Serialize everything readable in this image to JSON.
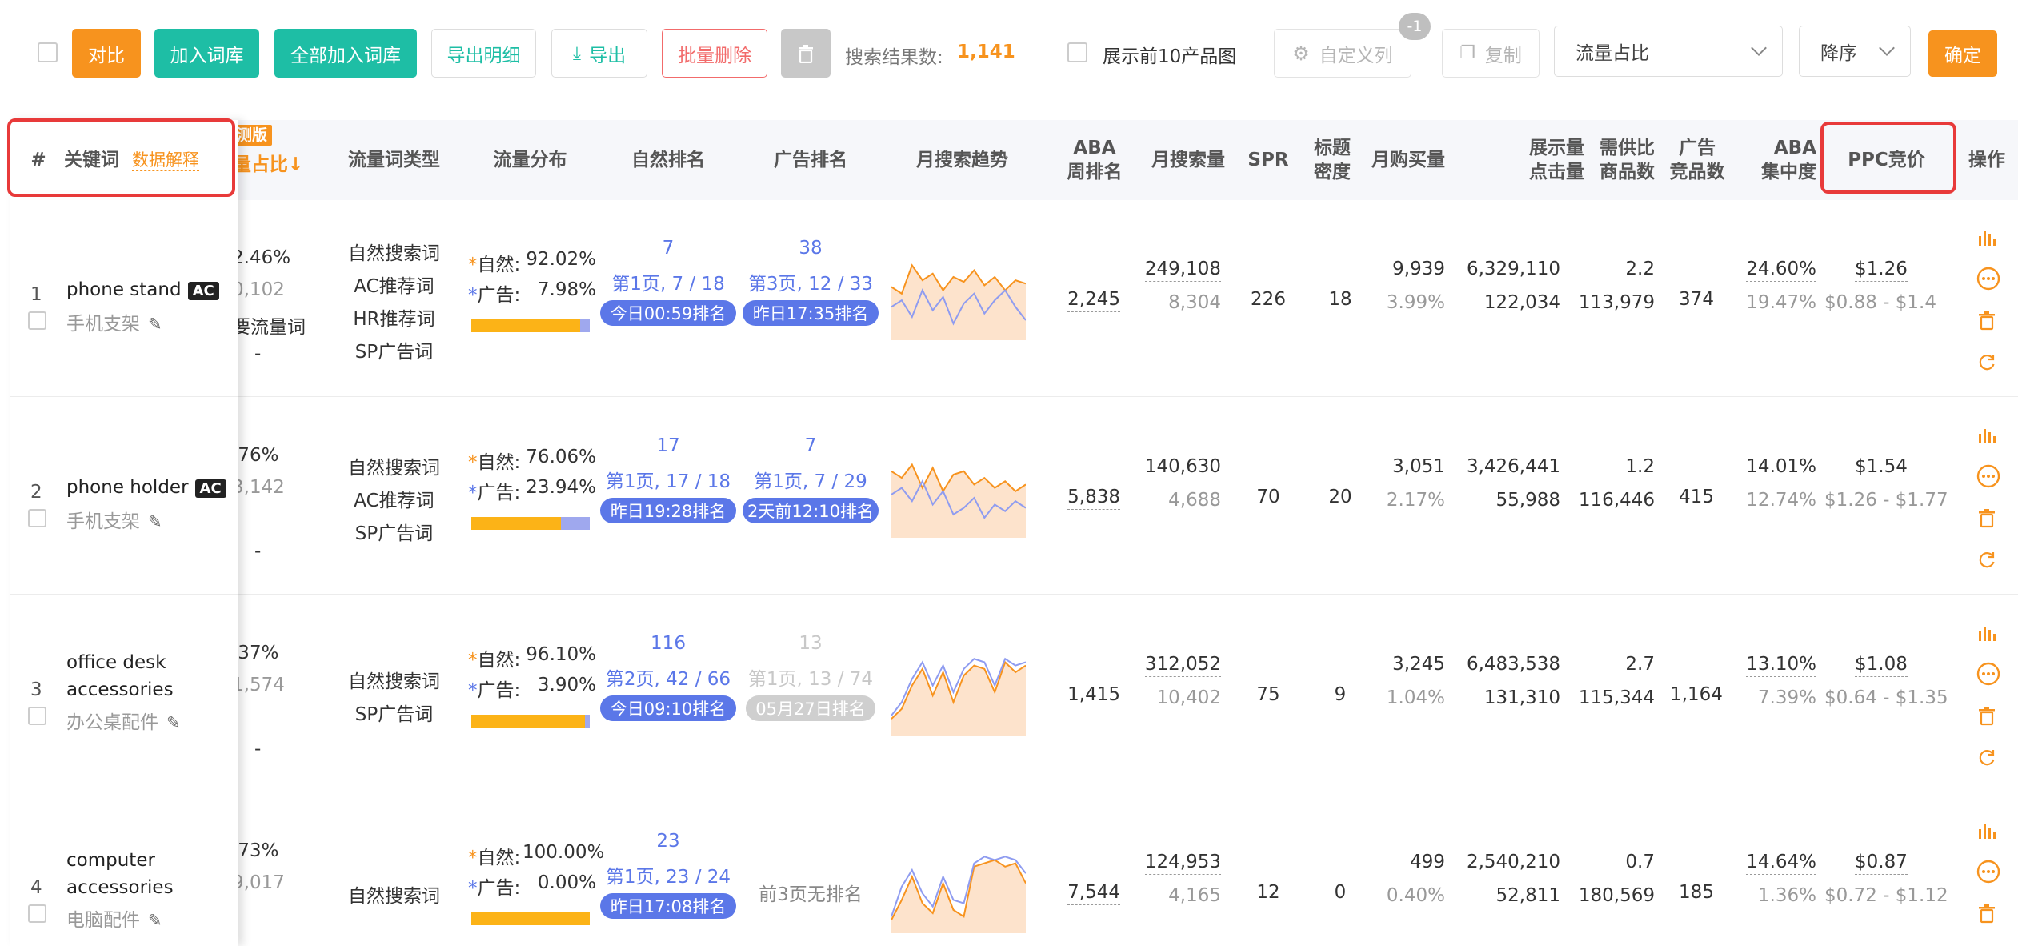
{
  "toolbar": {
    "compare": "对比",
    "add_lib": "加入词库",
    "add_all_lib": "全部加入词库",
    "export_detail": "导出明细",
    "export": "导出",
    "batch_delete": "批量删除",
    "result_label": "搜索结果数:",
    "result_count": "1,141",
    "show_top10": "展示前10产品图",
    "custom_cols": "自定义列",
    "custom_badge": "-1",
    "copy": "复制",
    "sort_field": "流量占比",
    "sort_order": "降序",
    "confirm": "确定"
  },
  "table": {
    "headers": {
      "index": "#",
      "keyword": "关键词",
      "data_explain": "数据解释",
      "badge": "测版",
      "share": "量占比↓",
      "type": "流量词类型",
      "dist": "流量分布",
      "natural_rank": "自然排名",
      "ad_rank": "广告排名",
      "trend": "月搜索趋势",
      "aba1": "ABA",
      "aba2": "周排名",
      "monthly_search": "月搜索量",
      "spr": "SPR",
      "title1": "标题",
      "title2": "密度",
      "monthly_buy": "月购买量",
      "imp1": "展示量",
      "imp2": "点击量",
      "supply1": "需供比",
      "supply2": "商品数",
      "ad1": "广告",
      "ad2": "竞品数",
      "conc1": "ABA",
      "conc2": "集中度",
      "ppc": "PPC竞价",
      "ops": "操作"
    },
    "rows": [
      {
        "idx": "1",
        "kw1": "phone stand",
        "kw2": "",
        "ac": "AC",
        "cn": "手机支架",
        "share": "2.46%",
        "share_sub": "0,102",
        "share_type": "要流量词",
        "share_dash": "-",
        "types": [
          "自然搜索词",
          "AC推荐词",
          "HR推荐词",
          "SP广告词"
        ],
        "nat_label": "自然:",
        "nat_pct": "92.02%",
        "ad_label": "广告:",
        "ad_pct": "7.98%",
        "nat_ratio": 0.92,
        "nr_num": "7",
        "nr_page": "第1页, 7 / 18",
        "nr_pill": "今日00:59排名",
        "ar_num": "38",
        "ar_page": "第3页, 12 / 33",
        "ar_pill": "昨日17:35排名",
        "ar_disabled": false,
        "trend_orange": [
          32,
          28,
          45,
          36,
          40,
          30,
          38,
          35,
          42,
          33,
          38,
          30,
          36,
          34
        ],
        "trend_blue": [
          20,
          24,
          14,
          30,
          18,
          26,
          10,
          22,
          28,
          16,
          24,
          30,
          20,
          12
        ],
        "aba": "2,245",
        "ms": "249,108",
        "ms_sub": "8,304",
        "spr": "226",
        "td": "18",
        "mb": "9,939",
        "mb_sub": "3.99%",
        "imp": "6,329,110",
        "clk": "122,034",
        "sd": "2.2",
        "sd_sub": "113,979",
        "adc": "374",
        "conc": "24.60%",
        "conc_sub": "19.47%",
        "ppc": "$1.26",
        "ppc_sub": "$0.88 - $1.4"
      },
      {
        "idx": "2",
        "kw1": "phone holder",
        "kw2": "",
        "ac": "AC",
        "cn": "手机支架",
        "share": ".76%",
        "share_sub": "3,142",
        "share_type": "",
        "share_dash": "-",
        "types": [
          "自然搜索词",
          "AC推荐词",
          "SP广告词"
        ],
        "nat_label": "自然:",
        "nat_pct": "76.06%",
        "ad_label": "广告:",
        "ad_pct": "23.94%",
        "nat_ratio": 0.76,
        "nr_num": "17",
        "nr_page": "第1页, 17 / 18",
        "nr_pill": "昨日19:28排名",
        "ar_num": "7",
        "ar_page": "第1页, 7 / 29",
        "ar_pill": "2天前12:10排名",
        "ar_disabled": false,
        "trend_orange": [
          40,
          36,
          44,
          30,
          42,
          28,
          38,
          40,
          32,
          36,
          30,
          34,
          28,
          32
        ],
        "trend_blue": [
          26,
          30,
          22,
          34,
          20,
          28,
          14,
          18,
          24,
          12,
          20,
          16,
          22,
          18
        ],
        "aba": "5,838",
        "ms": "140,630",
        "ms_sub": "4,688",
        "spr": "70",
        "td": "20",
        "mb": "3,051",
        "mb_sub": "2.17%",
        "imp": "3,426,441",
        "clk": "55,988",
        "sd": "1.2",
        "sd_sub": "116,446",
        "adc": "415",
        "conc": "14.01%",
        "conc_sub": "12.74%",
        "ppc": "$1.54",
        "ppc_sub": "$1.26 - $1.77"
      },
      {
        "idx": "3",
        "kw1": "office desk",
        "kw2": "accessories",
        "ac": "",
        "cn": "办公桌配件",
        "share": ".37%",
        "share_sub": "1,574",
        "share_type": "",
        "share_dash": "-",
        "types": [
          "自然搜索词",
          "SP广告词"
        ],
        "nat_label": "自然:",
        "nat_pct": "96.10%",
        "ad_label": "广告:",
        "ad_pct": "3.90%",
        "nat_ratio": 0.96,
        "nr_num": "116",
        "nr_page": "第2页, 42 / 66",
        "nr_pill": "今日09:10排名",
        "ar_num": "13",
        "ar_page": "第1页, 13 / 74",
        "ar_pill": "05月27日排名",
        "ar_disabled": true,
        "trend_orange": [
          10,
          16,
          30,
          40,
          24,
          38,
          20,
          36,
          42,
          40,
          26,
          44,
          38,
          42
        ],
        "trend_blue": [
          12,
          20,
          34,
          44,
          30,
          42,
          26,
          40,
          46,
          44,
          30,
          46,
          42,
          44
        ],
        "aba": "1,415",
        "ms": "312,052",
        "ms_sub": "10,402",
        "spr": "75",
        "td": "9",
        "mb": "3,245",
        "mb_sub": "1.04%",
        "imp": "6,483,538",
        "clk": "131,310",
        "sd": "2.7",
        "sd_sub": "115,344",
        "adc": "1,164",
        "conc": "13.10%",
        "conc_sub": "7.39%",
        "ppc": "$1.08",
        "ppc_sub": "$0.64 - $1.35"
      },
      {
        "idx": "4",
        "kw1": "computer",
        "kw2": "accessories",
        "ac": "",
        "cn": "电脑配件",
        "share": ".73%",
        "share_sub": "9,017",
        "share_type": "",
        "share_dash": "-",
        "types": [
          "自然搜索词"
        ],
        "nat_label": "自然:",
        "nat_pct": "100.00%",
        "ad_label": "广告:",
        "ad_pct": "0.00%",
        "nat_ratio": 1.0,
        "nr_num": "23",
        "nr_page": "第1页, 23 / 24",
        "nr_pill": "昨日17:08排名",
        "ar_none": "前3页无排名",
        "trend_orange": [
          8,
          20,
          34,
          18,
          12,
          30,
          14,
          10,
          40,
          42,
          44,
          40,
          42,
          30
        ],
        "trend_blue": [
          10,
          28,
          38,
          24,
          16,
          34,
          20,
          18,
          42,
          46,
          44,
          46,
          44,
          36
        ],
        "aba": "7,544",
        "ms": "124,953",
        "ms_sub": "4,165",
        "spr": "12",
        "td": "0",
        "mb": "499",
        "mb_sub": "0.40%",
        "imp": "2,540,210",
        "clk": "52,811",
        "sd": "0.7",
        "sd_sub": "180,569",
        "adc": "185",
        "conc": "14.64%",
        "conc_sub": "1.36%",
        "ppc": "$0.87",
        "ppc_sub": "$0.72 - $1.12"
      }
    ]
  },
  "colors": {
    "orange": "#f7931e",
    "teal": "#1ebea5",
    "blue": "#5b77e8",
    "red": "#e83a3a"
  }
}
